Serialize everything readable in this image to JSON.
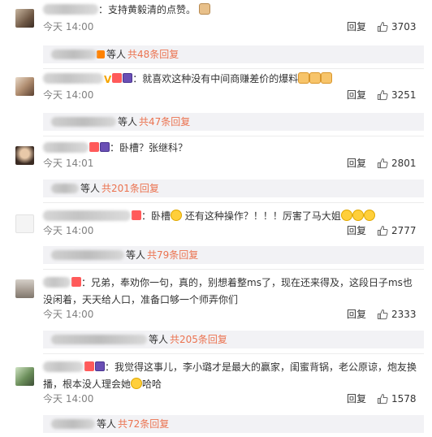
{
  "comments": [
    {
      "text": "：支持黄毅清的点赞。",
      "time": "今天 14:00",
      "reply": "回复",
      "likes": "3703",
      "sub_etal": "等人",
      "sub_total": "共48条回复"
    },
    {
      "text": "：就喜欢这种没有中间商赚差价的爆料",
      "time": "今天 14:00",
      "reply": "回复",
      "likes": "3251",
      "sub_etal": "等人",
      "sub_total": "共47条回复"
    },
    {
      "text": "：卧槽？张继科？",
      "time": "今天 14:01",
      "reply": "回复",
      "likes": "2801",
      "sub_etal": "等人",
      "sub_total": "共201条回复"
    },
    {
      "text_a": "：卧槽",
      "text_b": " 还有这种操作？！！！厉害了马大姐",
      "time": "今天 14:00",
      "reply": "回复",
      "likes": "2777",
      "sub_etal": "等人",
      "sub_total": "共79条回复"
    },
    {
      "line1": "：兄弟，奉劝你一句，真的，别想着整ms了，现在还来得及，这段日子ms也",
      "line2": "没闲着，天天给人口，准备口够一个师弄你们",
      "time": "今天 14:00",
      "reply": "回复",
      "likes": "2333",
      "sub_etal": "等人",
      "sub_total": "共205条回复"
    },
    {
      "line1": "：我觉得这事儿，李小璐才是最大的赢家，闺蜜背锅，老公原谅，炮友换",
      "line2_a": "播，根本没人理会她",
      "line2_b": "哈哈",
      "time": "今天 14:00",
      "reply": "回复",
      "likes": "1578",
      "sub_etal": "等人",
      "sub_total": "共72条回复"
    }
  ],
  "colors": {
    "link": "#eb7350",
    "meta": "#808080",
    "sub_bg": "#f2f2f5"
  },
  "icons": [
    "thumb-up-icon",
    "vip-badge-icon",
    "emoji-icon"
  ]
}
